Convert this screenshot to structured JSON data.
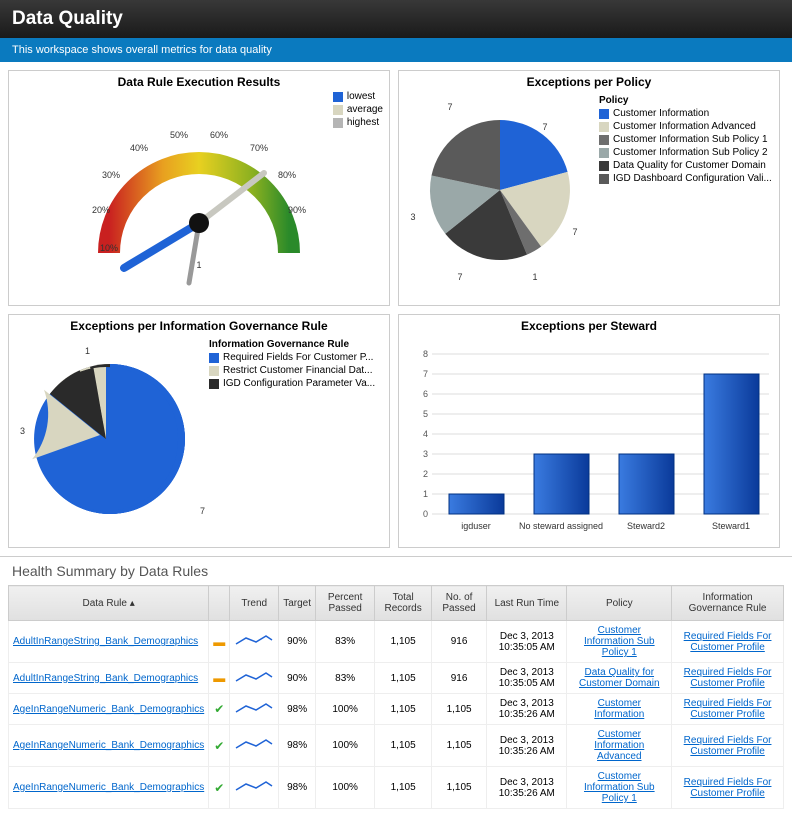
{
  "header": {
    "title": "Data Quality",
    "subtitle": "This workspace shows overall metrics for data quality"
  },
  "panels": {
    "gauge": {
      "title": "Data Rule Execution Results",
      "ticks": [
        "10%",
        "20%",
        "30%",
        "40%",
        "50%",
        "60%",
        "70%",
        "80%",
        "90%"
      ],
      "unlabeled_tick": "1",
      "legend": [
        {
          "label": "lowest",
          "color": "#1f63d6"
        },
        {
          "label": "average",
          "color": "#d8d6c0"
        },
        {
          "label": "highest",
          "color": "#b5b5b5"
        }
      ]
    },
    "policy_pie": {
      "title": "Exceptions per Policy",
      "legend_title": "Policy",
      "legend": [
        {
          "label": "Customer Information",
          "color": "#1f63d6"
        },
        {
          "label": "Customer Information Advanced",
          "color": "#d8d6c0"
        },
        {
          "label": "Customer Information Sub Policy 1",
          "color": "#6e6e6e"
        },
        {
          "label": "Customer Information Sub Policy 2",
          "color": "#9aa8a8"
        },
        {
          "label": "Data Quality for Customer Domain",
          "color": "#3a3a3a"
        },
        {
          "label": "IGD Dashboard Configuration Vali...",
          "color": "#5a5a5a"
        }
      ],
      "slice_labels": [
        "7",
        "7",
        "1",
        "7",
        "3",
        "7"
      ]
    },
    "rule_pie": {
      "title": "Exceptions per Information Governance Rule",
      "legend_title": "Information Governance Rule",
      "legend": [
        {
          "label": "Required Fields For Customer P...",
          "color": "#1f63d6"
        },
        {
          "label": "Restrict Customer Financial Dat...",
          "color": "#d8d6c0"
        },
        {
          "label": "IGD Configuration Parameter Va...",
          "color": "#2a2a2a"
        }
      ],
      "slice_labels": [
        "7",
        "3",
        "1"
      ]
    },
    "steward_bar": {
      "title": "Exceptions per Steward",
      "categories": [
        "igduser",
        "No steward assigned",
        "Steward2",
        "Steward1"
      ],
      "values": [
        1,
        3,
        3,
        7
      ],
      "yticks": [
        "0",
        "1",
        "2",
        "3",
        "4",
        "5",
        "6",
        "7",
        "8"
      ]
    }
  },
  "summary": {
    "title": "Health Summary by Data Rules",
    "columns": [
      "Data Rule",
      "",
      "Trend",
      "Target",
      "Percent Passed",
      "Total Records",
      "No. of Passed",
      "Last Run Time",
      "Policy",
      "Information Governance Rule"
    ],
    "rows": [
      {
        "rule": "AdultInRangeString_Bank_Demographics",
        "status": "warn",
        "target": "90%",
        "pct": "83%",
        "total": "1,105",
        "passed": "916",
        "time": "Dec 3, 2013 10:35:05 AM",
        "policy": "Customer Information Sub Policy 1",
        "gov": "Required Fields For Customer Profile"
      },
      {
        "rule": "AdultInRangeString_Bank_Demographics",
        "status": "warn",
        "target": "90%",
        "pct": "83%",
        "total": "1,105",
        "passed": "916",
        "time": "Dec 3, 2013 10:35:05 AM",
        "policy": "Data Quality for Customer Domain",
        "gov": "Required Fields For Customer Profile"
      },
      {
        "rule": "AgeInRangeNumeric_Bank_Demographics",
        "status": "ok",
        "target": "98%",
        "pct": "100%",
        "total": "1,105",
        "passed": "1,105",
        "time": "Dec 3, 2013 10:35:26 AM",
        "policy": "Customer Information",
        "gov": "Required Fields For Customer Profile"
      },
      {
        "rule": "AgeInRangeNumeric_Bank_Demographics",
        "status": "ok",
        "target": "98%",
        "pct": "100%",
        "total": "1,105",
        "passed": "1,105",
        "time": "Dec 3, 2013 10:35:26 AM",
        "policy": "Customer Information Advanced",
        "gov": "Required Fields For Customer Profile"
      },
      {
        "rule": "AgeInRangeNumeric_Bank_Demographics",
        "status": "ok",
        "target": "98%",
        "pct": "100%",
        "total": "1,105",
        "passed": "1,105",
        "time": "Dec 3, 2013 10:35:26 AM",
        "policy": "Customer Information Sub Policy 1",
        "gov": "Required Fields For Customer Profile"
      }
    ]
  },
  "chart_data": [
    {
      "type": "pie",
      "title": "Exceptions per Policy",
      "series": [
        {
          "name": "Exceptions",
          "values": [
            7,
            7,
            1,
            7,
            3,
            7
          ]
        }
      ],
      "categories": [
        "Customer Information",
        "Customer Information Advanced",
        "Customer Information Sub Policy 1",
        "Customer Information Sub Policy 2",
        "Data Quality for Customer Domain",
        "IGD Dashboard Configuration Validation"
      ]
    },
    {
      "type": "pie",
      "title": "Exceptions per Information Governance Rule",
      "series": [
        {
          "name": "Exceptions",
          "values": [
            7,
            3,
            1
          ]
        }
      ],
      "categories": [
        "Required Fields For Customer Profile",
        "Restrict Customer Financial Data",
        "IGD Configuration Parameter Validation"
      ]
    },
    {
      "type": "bar",
      "title": "Exceptions per Steward",
      "categories": [
        "igduser",
        "No steward assigned",
        "Steward2",
        "Steward1"
      ],
      "values": [
        1,
        3,
        3,
        7
      ],
      "ylim": [
        0,
        8
      ]
    }
  ]
}
